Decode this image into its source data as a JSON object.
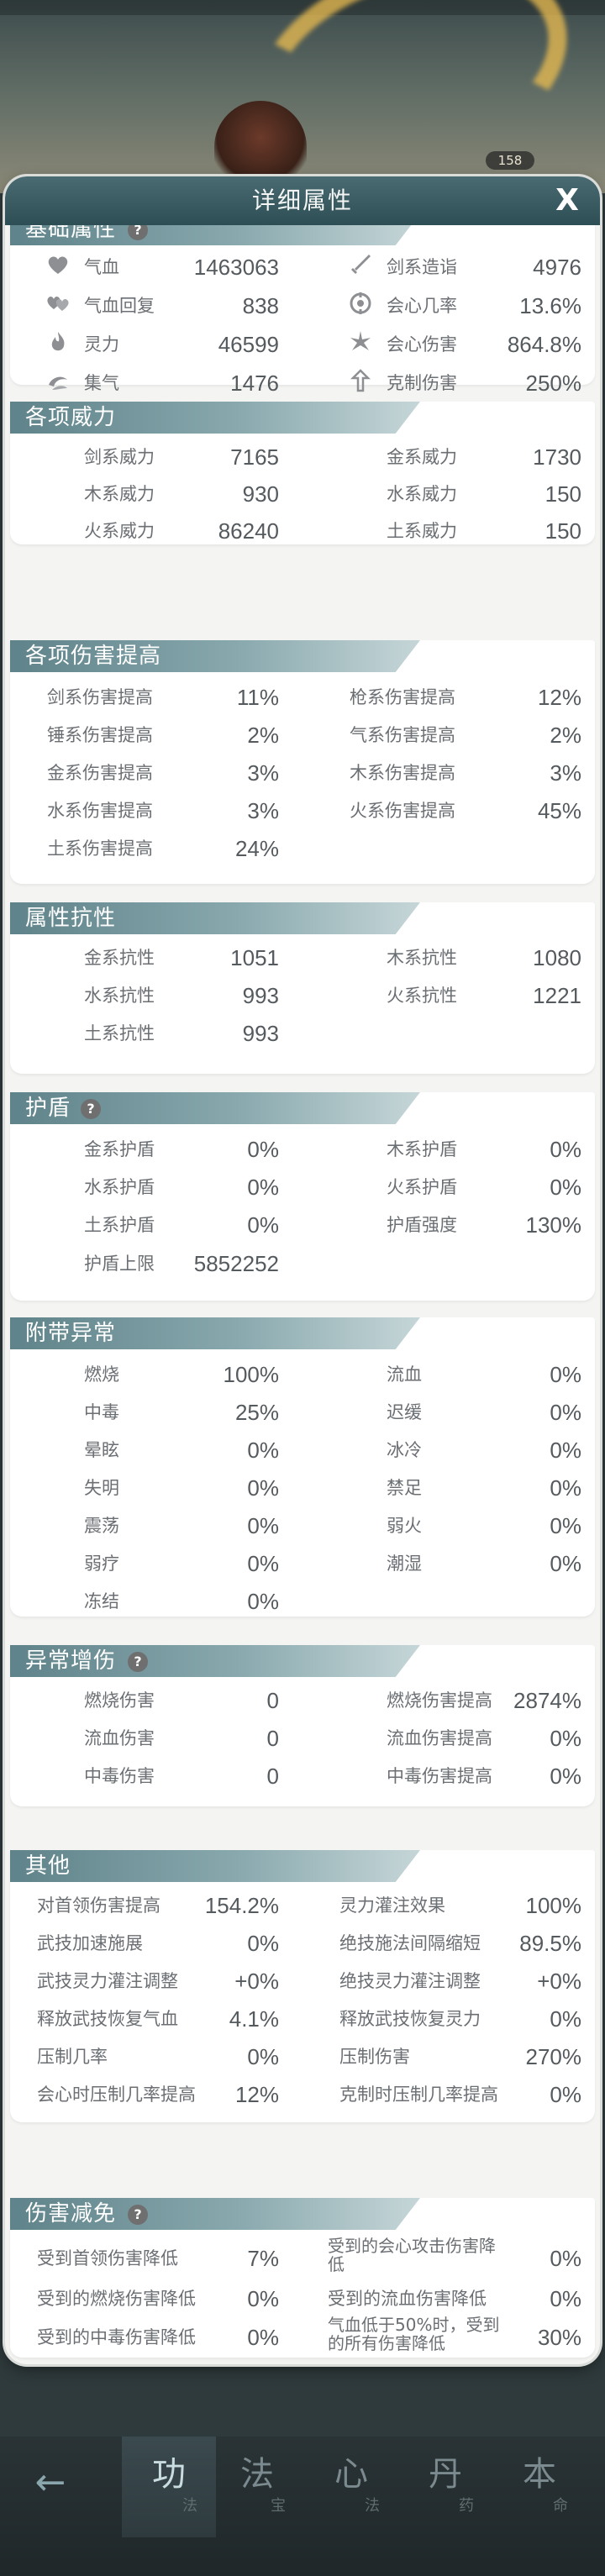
{
  "background": {
    "follower_count": "158"
  },
  "modal": {
    "title": "详细属性",
    "close_label": "X"
  },
  "base_section": {
    "title": "基础属性",
    "items": [
      {
        "icon": "heart-icon",
        "label": "气血",
        "value": "1463063"
      },
      {
        "icon": "sword-icon",
        "label": "剑系造诣",
        "value": "4976"
      },
      {
        "icon": "twin-hearts-icon",
        "label": "气血回复",
        "value": "838"
      },
      {
        "icon": "crit-rate-icon",
        "label": "会心几率",
        "value": "13.6%"
      },
      {
        "icon": "flame-icon",
        "label": "灵力",
        "value": "46599"
      },
      {
        "icon": "crit-damage-icon",
        "label": "会心伤害",
        "value": "864.8%"
      },
      {
        "icon": "swirl-icon",
        "label": "集气",
        "value": "1476"
      },
      {
        "icon": "counter-icon",
        "label": "克制伤害",
        "value": "250%"
      }
    ]
  },
  "power_section": {
    "title": "各项威力",
    "items": [
      {
        "label": "剑系威力",
        "value": "7165"
      },
      {
        "label": "金系威力",
        "value": "1730"
      },
      {
        "label": "木系威力",
        "value": "930"
      },
      {
        "label": "水系威力",
        "value": "150"
      },
      {
        "label": "火系威力",
        "value": "86240"
      },
      {
        "label": "土系威力",
        "value": "150"
      }
    ]
  },
  "damage_boost_section": {
    "title": "各项伤害提高",
    "items": [
      {
        "label": "剑系伤害提高",
        "value": "11%"
      },
      {
        "label": "枪系伤害提高",
        "value": "12%"
      },
      {
        "label": "锤系伤害提高",
        "value": "2%"
      },
      {
        "label": "气系伤害提高",
        "value": "2%"
      },
      {
        "label": "金系伤害提高",
        "value": "3%"
      },
      {
        "label": "木系伤害提高",
        "value": "3%"
      },
      {
        "label": "水系伤害提高",
        "value": "3%"
      },
      {
        "label": "火系伤害提高",
        "value": "45%"
      },
      {
        "label": "土系伤害提高",
        "value": "24%"
      }
    ]
  },
  "resist_section": {
    "title": "属性抗性",
    "items": [
      {
        "label": "金系抗性",
        "value": "1051"
      },
      {
        "label": "木系抗性",
        "value": "1080"
      },
      {
        "label": "水系抗性",
        "value": "993"
      },
      {
        "label": "火系抗性",
        "value": "1221"
      },
      {
        "label": "土系抗性",
        "value": "993"
      }
    ]
  },
  "shield_section": {
    "title": "护盾",
    "items": [
      {
        "label": "金系护盾",
        "value": "0%"
      },
      {
        "label": "木系护盾",
        "value": "0%"
      },
      {
        "label": "水系护盾",
        "value": "0%"
      },
      {
        "label": "火系护盾",
        "value": "0%"
      },
      {
        "label": "土系护盾",
        "value": "0%"
      },
      {
        "label": "护盾强度",
        "value": "130%"
      },
      {
        "label": "护盾上限",
        "value": "5852252"
      }
    ]
  },
  "status_section": {
    "title": "附带异常",
    "items": [
      {
        "label": "燃烧",
        "value": "100%"
      },
      {
        "label": "流血",
        "value": "0%"
      },
      {
        "label": "中毒",
        "value": "25%"
      },
      {
        "label": "迟缓",
        "value": "0%"
      },
      {
        "label": "晕眩",
        "value": "0%"
      },
      {
        "label": "冰冷",
        "value": "0%"
      },
      {
        "label": "失明",
        "value": "0%"
      },
      {
        "label": "禁足",
        "value": "0%"
      },
      {
        "label": "震荡",
        "value": "0%"
      },
      {
        "label": "弱火",
        "value": "0%"
      },
      {
        "label": "弱疗",
        "value": "0%"
      },
      {
        "label": "潮湿",
        "value": "0%"
      },
      {
        "label": "冻结",
        "value": "0%"
      }
    ]
  },
  "status_damage_section": {
    "title": "异常增伤",
    "items": [
      {
        "label": "燃烧伤害",
        "value": "0"
      },
      {
        "label": "燃烧伤害提高",
        "value": "2874%"
      },
      {
        "label": "流血伤害",
        "value": "0"
      },
      {
        "label": "流血伤害提高",
        "value": "0%"
      },
      {
        "label": "中毒伤害",
        "value": "0"
      },
      {
        "label": "中毒伤害提高",
        "value": "0%"
      }
    ]
  },
  "other_section": {
    "title": "其他",
    "items": [
      {
        "label": "对首领伤害提高",
        "value": "154.2%"
      },
      {
        "label": "灵力灌注效果",
        "value": "100%"
      },
      {
        "label": "武技加速施展",
        "value": "0%"
      },
      {
        "label": "绝技施法间隔缩短",
        "value": "89.5%"
      },
      {
        "label": "武技灵力灌注调整",
        "value": "+0%"
      },
      {
        "label": "绝技灵力灌注调整",
        "value": "+0%"
      },
      {
        "label": "释放武技恢复气血",
        "value": "4.1%"
      },
      {
        "label": "释放武技恢复灵力",
        "value": "0%"
      },
      {
        "label": "压制几率",
        "value": "0%"
      },
      {
        "label": "压制伤害",
        "value": "270%"
      },
      {
        "label": "会心时压制几率提高",
        "value": "12%"
      },
      {
        "label": "克制时压制几率提高",
        "value": "0%"
      }
    ]
  },
  "reduction_section": {
    "title": "伤害减免",
    "items": [
      {
        "label": "受到首领伤害降低",
        "value": "7%"
      },
      {
        "label": "受到的会心攻击伤害降低",
        "value": "0%"
      },
      {
        "label": "受到的燃烧伤害降低",
        "value": "0%"
      },
      {
        "label": "受到的流血伤害降低",
        "value": "0%"
      },
      {
        "label": "受到的中毒伤害降低",
        "value": "0%"
      },
      {
        "label": "气血低于50%时，受到的所有伤害降低",
        "value": "30%"
      }
    ]
  },
  "bottom_nav": {
    "tabs": [
      {
        "big": "功",
        "small": "法"
      },
      {
        "big": "法",
        "small": "宝"
      },
      {
        "big": "心",
        "small": "法"
      },
      {
        "big": "丹",
        "small": "药"
      },
      {
        "big": "本",
        "small": "命"
      }
    ]
  }
}
